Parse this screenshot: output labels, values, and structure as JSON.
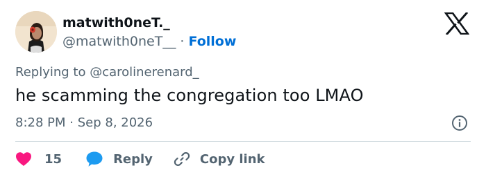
{
  "author": {
    "display_name": "matwith0neT._",
    "handle": "@matwith0neT__",
    "separator": "·",
    "follow_label": "Follow"
  },
  "reply_context": {
    "prefix": "Replying to ",
    "mention": "@carolinerenard_"
  },
  "tweet": {
    "text": "he scamming the congregation too LMAO",
    "time": "8:28 PM",
    "separator": "·",
    "date": "Sep 8, 2026"
  },
  "actions": {
    "likes_count": "15",
    "reply_label": "Reply",
    "copy_link_label": "Copy link"
  },
  "icons": {
    "brand": "x-logo-icon",
    "info": "info-icon",
    "like": "heart-icon",
    "reply": "speech-bubble-icon",
    "copy": "link-icon"
  },
  "colors": {
    "text_primary": "#0f1419",
    "text_secondary": "#536471",
    "follow": "#006fd6",
    "heart": "#f91880",
    "reply_bubble": "#1d9bf0",
    "divider": "#cfd9de"
  }
}
